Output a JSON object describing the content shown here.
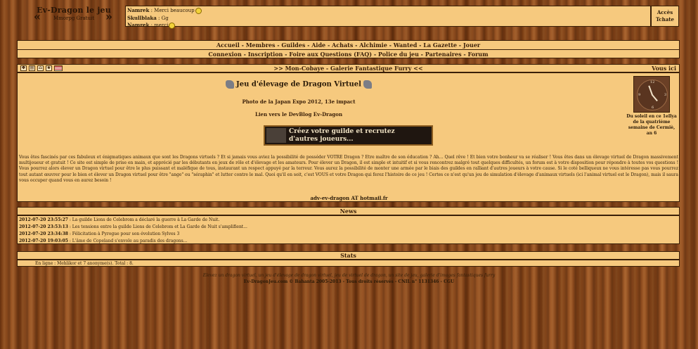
{
  "header": {
    "logo_title": "Ev-Dragon le jeu",
    "logo_subtitle": "Mmorpg Gratuit",
    "logo_arrow_left": "«",
    "logo_arrow_right": "»",
    "chat": [
      {
        "who": "Namrek",
        "msg": " : Merci beaucoup",
        "smiley": true
      },
      {
        "who": "Skullblaka",
        "msg": " : Gg",
        "smiley": false
      },
      {
        "who": "Namrek",
        "msg": " : merci",
        "smiley": true
      }
    ],
    "access_line1": "Accès",
    "access_line2": "Tchate"
  },
  "nav": {
    "row1": [
      "Accueil",
      "Membres",
      "Guildes",
      "Aide",
      "Achats",
      "Alchimie",
      "Wanted",
      "La Gazette",
      "Jouer"
    ],
    "row2": [
      "Connexion",
      "Inscription",
      "Foire aux Questions (FAQ)",
      "Police du jeu",
      "Partenaires",
      "Forum"
    ]
  },
  "titlebar": {
    "breadcrumb": ">> Mon-Cobaye - Galerie Fantastique Furry <<",
    "you_here": "Vous ici"
  },
  "main": {
    "title": "Jeu d'élevage de Dragon Virtuel",
    "photo_line": "Photo de la Japan Expo 2012, 13e impact",
    "devblog_line": "Lien vers le DevBlog Ev-Dragon",
    "banner_text_1": "Créez votre guilde et recrutez",
    "banner_text_2": "d'autres joueurs...",
    "description": "Vous êtes fascinés par ces fabuleux et énigmatiques animaux que sont les Dragons virtuels ? Et si jamais vous aviez la possibilité de posséder VOTRE Dragon ? Etre maître de son éducation ? Ah... Quel rêve ! Et bien votre bonheur va se réaliser ! Vous êtes dans un élevage virtuel de Dragon massivement multijoueur et gratuit ! Ce site est simple de prise en main, et apprécié par les débutants en jeux de rôle et d'élevage et les amateurs. Pour élever un Dragon, il est simple et intuitif et si vous rencontrez malgré tout quelques difficultés, un forum est à votre disposition pour répondre à toutes vos questions ! Vous pourrez alors élever un Dragon virtuel pour être le plus puissant et maléfique de tous, instaurant un respect appuyé par la terreur. Vous aurez la possibilité de monter une armée par le biais des guildes en ralliant d'autres joueurs à votre cause. Si le coté belliqueux ne vous intéresse pas vous pourrez tout autant œuvrer pour le bien et élever un Dragon virtuel pour être \"ange\" ou \"séraphin\" et lutter contre le mal. Quoi qu'il en soit, c'est VOUS et votre Dragon qui ferez l'histoire de ce jeu ! Certes ce n'est qu'un jeu de simulation d'élevage d'animaux virtuels (ici l'animal virtuel est le Dragon), mais il saura vous occuper quand vous en aurez besoin !",
    "email": "adv-ev-dragon AT hotmail.fr",
    "clock_caption": "Du soleil en ce 1ellya de la quatrième semaine de Cermiè, an 6"
  },
  "news": {
    "title": "News",
    "items": [
      {
        "date": "2012-07-20 23:55:27",
        "text": " : La guilde Lions de Celebrom a déclaré la guerre à La Garde de Nuit."
      },
      {
        "date": "2012-07-20 23:53:13",
        "text": " : Les tensions entre la guilde Lions de Celebrom et La Garde de Nuit s'amplifient..."
      },
      {
        "date": "2012-07-20 23:34:38",
        "text": " : Félicitation à Pyrogue pour son évolution Sylves 3"
      },
      {
        "date": "2012-07-20 19:03:05",
        "text": " : L'âme de Copeland s'envole au paradis des dragons..."
      }
    ]
  },
  "stats": {
    "title": "Stats",
    "online": "En ligne : Mehlikor et 7 anonyme(s). Total : 8."
  },
  "footer": {
    "line1": "Elevez un dragon virtuel, un jeu d'élevage de dragon virtuel, jeu de virtuel de dragon, un site de jeu, galerie d'images fantastiques furry",
    "line2": "Ev-DragonJeu.com © Bahanta 2005-2013 - Tous droits réservés - CNIL n° 1131346 - CGU"
  },
  "colors": {
    "panel_bg": "#f6c97e",
    "border": "#3a1f08",
    "wood": "#8a4a1c"
  }
}
